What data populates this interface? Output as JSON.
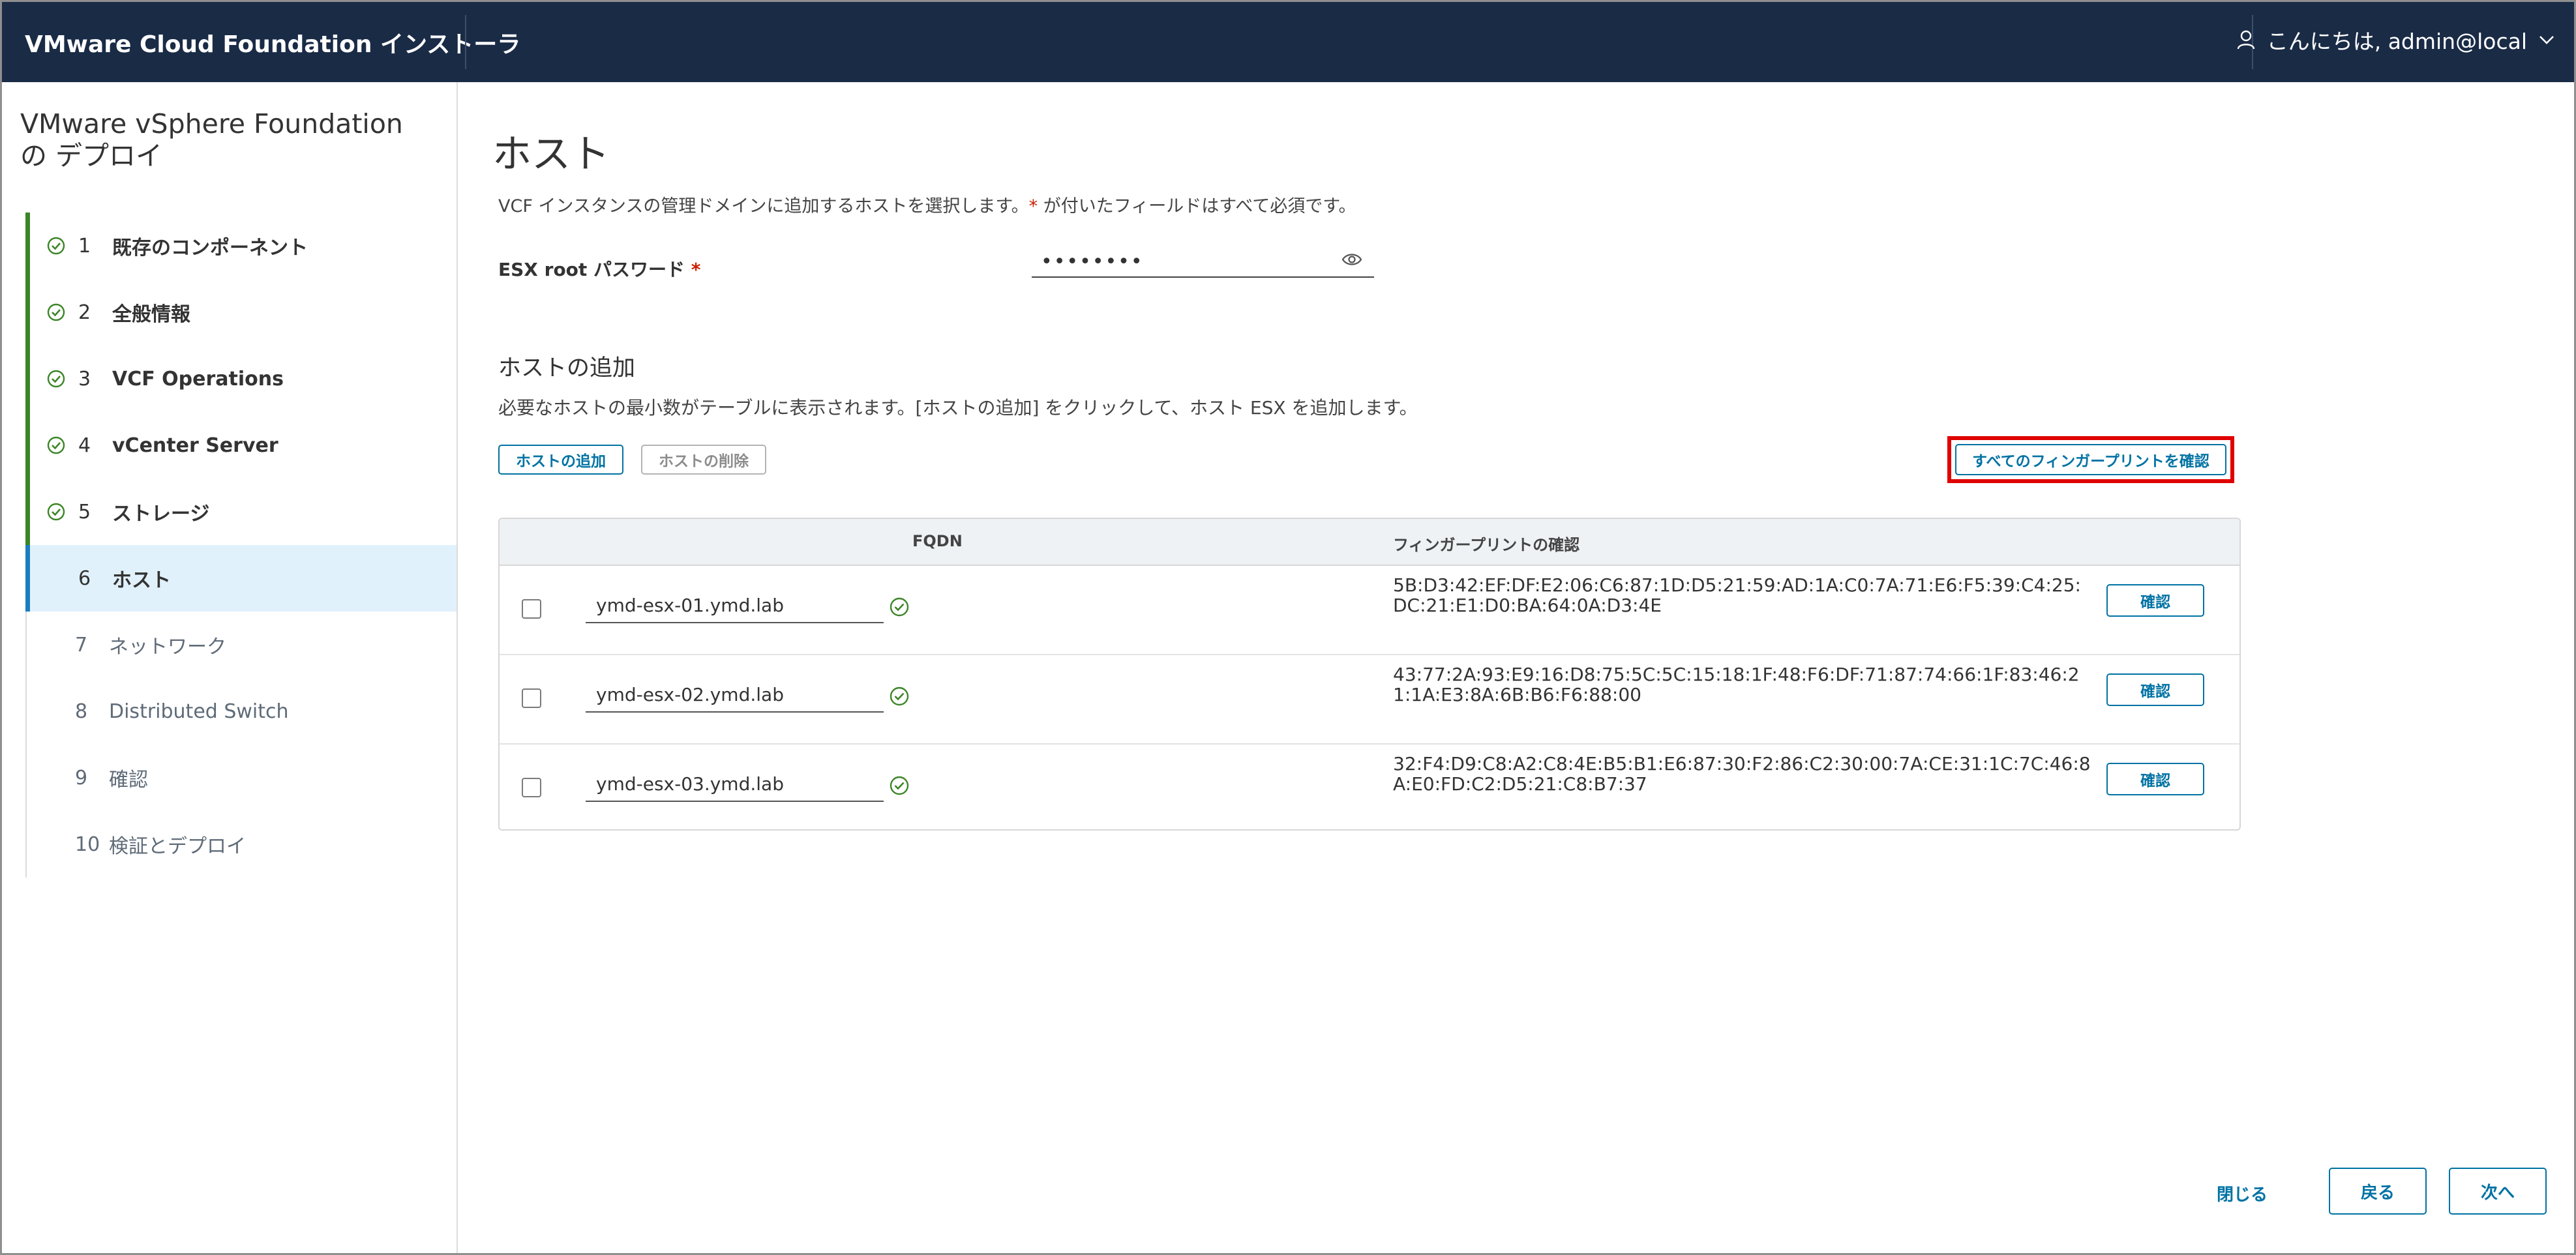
{
  "header": {
    "app_title": "VMware Cloud Foundation インストーラ",
    "user_greeting": "こんにちは, admin@local"
  },
  "sidebar": {
    "title": "VMware vSphere Foundation の デプロイ",
    "steps": [
      {
        "num": "1",
        "label": "既存のコンポーネント",
        "state": "done"
      },
      {
        "num": "2",
        "label": "全般情報",
        "state": "done"
      },
      {
        "num": "3",
        "label": "VCF Operations",
        "state": "done"
      },
      {
        "num": "4",
        "label": "vCenter Server",
        "state": "done"
      },
      {
        "num": "5",
        "label": "ストレージ",
        "state": "done"
      },
      {
        "num": "6",
        "label": "ホスト",
        "state": "active"
      },
      {
        "num": "7",
        "label": "ネットワーク",
        "state": "todo"
      },
      {
        "num": "8",
        "label": "Distributed Switch",
        "state": "todo"
      },
      {
        "num": "9",
        "label": "確認",
        "state": "todo"
      },
      {
        "num": "10",
        "label": "検証とデプロイ",
        "state": "todo"
      }
    ]
  },
  "main": {
    "title": "ホスト",
    "description_pre": "VCF インスタンスの管理ドメインに追加するホストを選択します。",
    "required_mark": "*",
    "description_post": " が付いたフィールドはすべて必須です。",
    "password_label": "ESX root パスワード",
    "password_value": "••••••••",
    "section_title": "ホストの追加",
    "section_description": "必要なホストの最小数がテーブルに表示されます。[ホストの追加] をクリックして、ホスト ESX を追加します。",
    "add_host_button": "ホストの追加",
    "remove_host_button": "ホストの削除",
    "verify_all_button": "すべてのフィンガープリントを確認"
  },
  "table": {
    "columns": [
      "FQDN",
      "フィンガープリントの確認"
    ],
    "rows": [
      {
        "fqdn": "ymd-esx-01.ymd.lab",
        "fingerprint": "5B:D3:42:EF:DF:E2:06:C6:87:1D:D5:21:59:AD:1A:C0:7A:71:E6:F5:39:C4:25:DC:21:E1:D0:BA:64:0A:D3:4E",
        "action": "確認"
      },
      {
        "fqdn": "ymd-esx-02.ymd.lab",
        "fingerprint": "43:77:2A:93:E9:16:D8:75:5C:5C:15:18:1F:48:F6:DF:71:87:74:66:1F:83:46:21:1A:E3:8A:6B:B6:F6:88:00",
        "action": "確認"
      },
      {
        "fqdn": "ymd-esx-03.ymd.lab",
        "fingerprint": "32:F4:D9:C8:A2:C8:4E:B5:B1:E6:87:30:F2:86:C2:30:00:7A:CE:31:1C:7C:46:8A:E0:FD:C2:D5:21:C8:B7:37",
        "action": "確認"
      }
    ]
  },
  "footer": {
    "close": "閉じる",
    "back": "戻る",
    "next": "次へ"
  },
  "colors": {
    "header_bg": "#1a2b46",
    "accent": "#0072a3",
    "done": "#3c8527",
    "active_bg": "#e1f1fb",
    "highlight": "#e00000"
  }
}
